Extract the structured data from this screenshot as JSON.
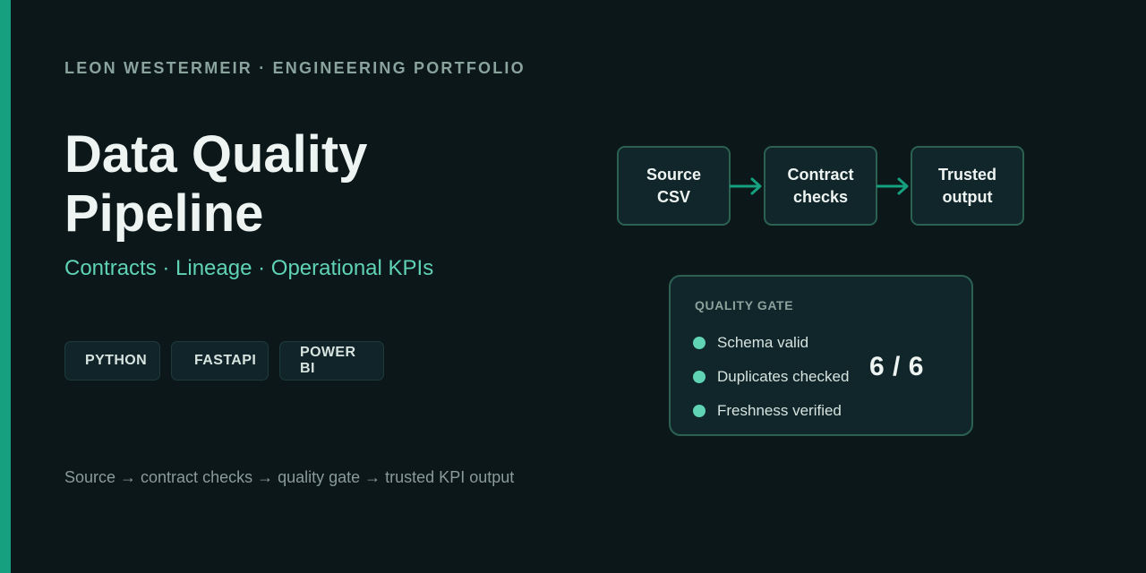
{
  "header": {
    "eyebrow": "LEON WESTERMEIR · ENGINEERING PORTFOLIO"
  },
  "hero": {
    "title_line1": "Data Quality",
    "title_line2": "Pipeline",
    "subtitle": "Contracts · Lineage · Operational KPIs"
  },
  "tags": [
    "PYTHON",
    "FASTAPI",
    "POWER BI"
  ],
  "footer": {
    "text": "Source → contract checks → quality gate → trusted KPI output"
  },
  "flow": {
    "nodes": [
      {
        "line1": "Source",
        "line2": "CSV"
      },
      {
        "line1": "Contract",
        "line2": "checks"
      },
      {
        "line1": "Trusted",
        "line2": "output"
      }
    ]
  },
  "gate": {
    "title": "QUALITY GATE",
    "items": [
      "Schema valid",
      "Duplicates checked",
      "Freshness verified"
    ],
    "count": "6 / 6"
  },
  "colors": {
    "background": "#0b1719",
    "accent": "#16a07f",
    "highlight": "#5fd3b4"
  }
}
